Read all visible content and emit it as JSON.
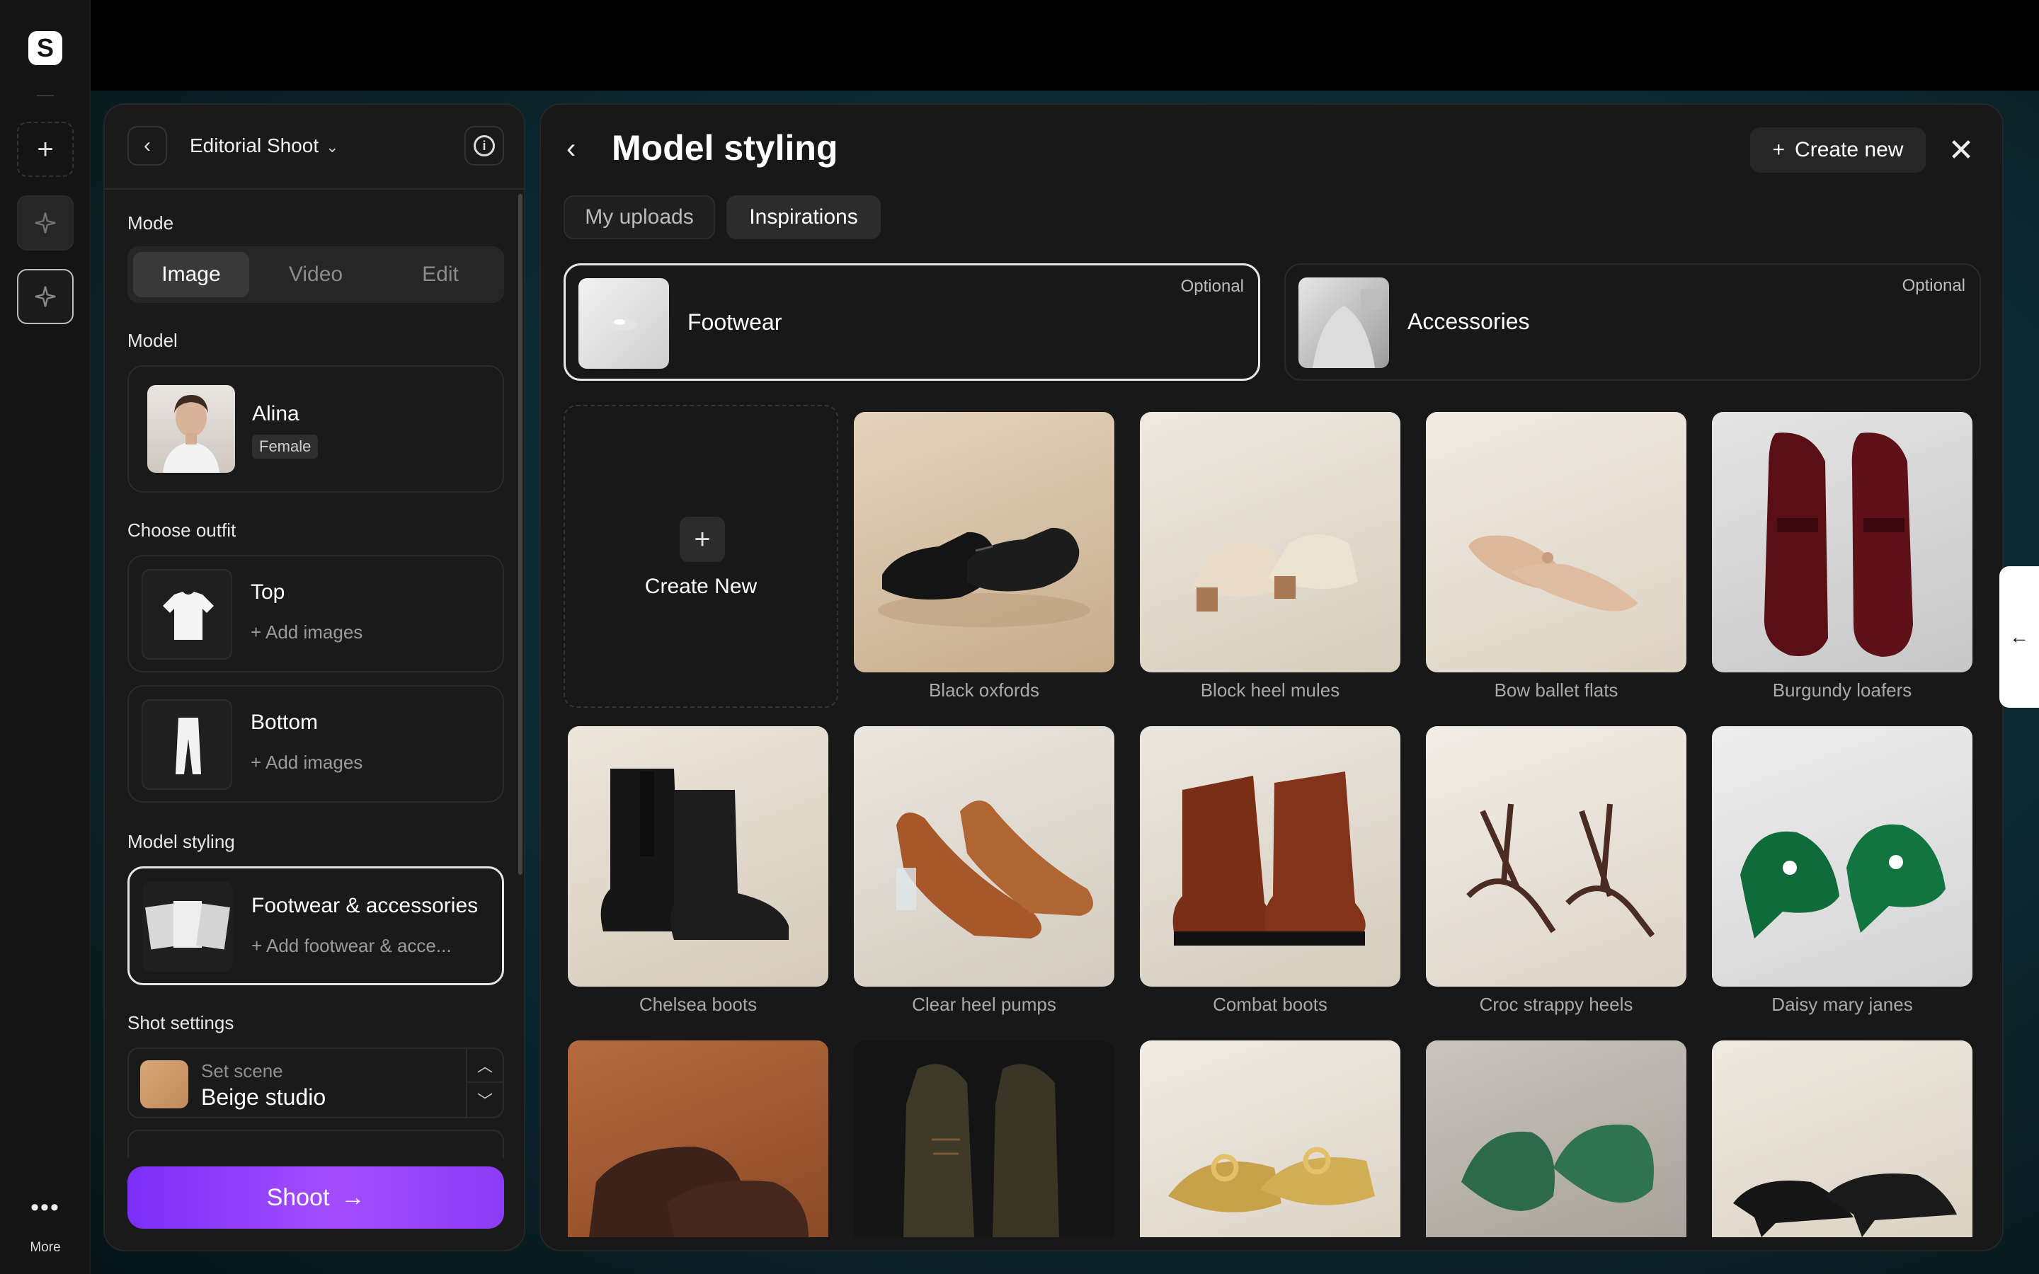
{
  "rail": {
    "logo": "S",
    "add_icon": "+",
    "more_dots": "•••",
    "more_label": "More"
  },
  "panel": {
    "header_title": "Editorial Shoot",
    "mode_label": "Mode",
    "modes": [
      "Image",
      "Video",
      "Edit"
    ],
    "selected_mode": "Image",
    "model_label": "Model",
    "model": {
      "name": "Alina",
      "tag": "Female"
    },
    "outfit_label": "Choose outfit",
    "outfit": [
      {
        "name": "Top",
        "action": "+ Add images"
      },
      {
        "name": "Bottom",
        "action": "+ Add images"
      }
    ],
    "styling_label": "Model styling",
    "styling": {
      "name": "Footwear & accessories",
      "action": "+ Add footwear & acce..."
    },
    "shot_label": "Shot settings",
    "scene": {
      "label": "Set scene",
      "value": "Beige studio",
      "swatch": "#d4a272"
    },
    "shoot_label": "Shoot",
    "shoot_color": "#8a3cf7"
  },
  "main": {
    "title": "Model styling",
    "create_new": "Create new",
    "tabs": [
      "My uploads",
      "Inspirations"
    ],
    "selected_tab": "Inspirations",
    "categories": [
      {
        "label": "Footwear",
        "badge": "Optional"
      },
      {
        "label": "Accessories",
        "badge": "Optional"
      }
    ],
    "create_tile_label": "Create New",
    "items": [
      "Black oxfords",
      "Block heel mules",
      "Bow ballet flats",
      "Burgundy loafers",
      "Chelsea boots",
      "Clear heel pumps",
      "Combat boots",
      "Croc strappy heels",
      "Daisy mary janes",
      "",
      "",
      "",
      "",
      ""
    ]
  },
  "side_tab": {
    "icon": "←"
  }
}
